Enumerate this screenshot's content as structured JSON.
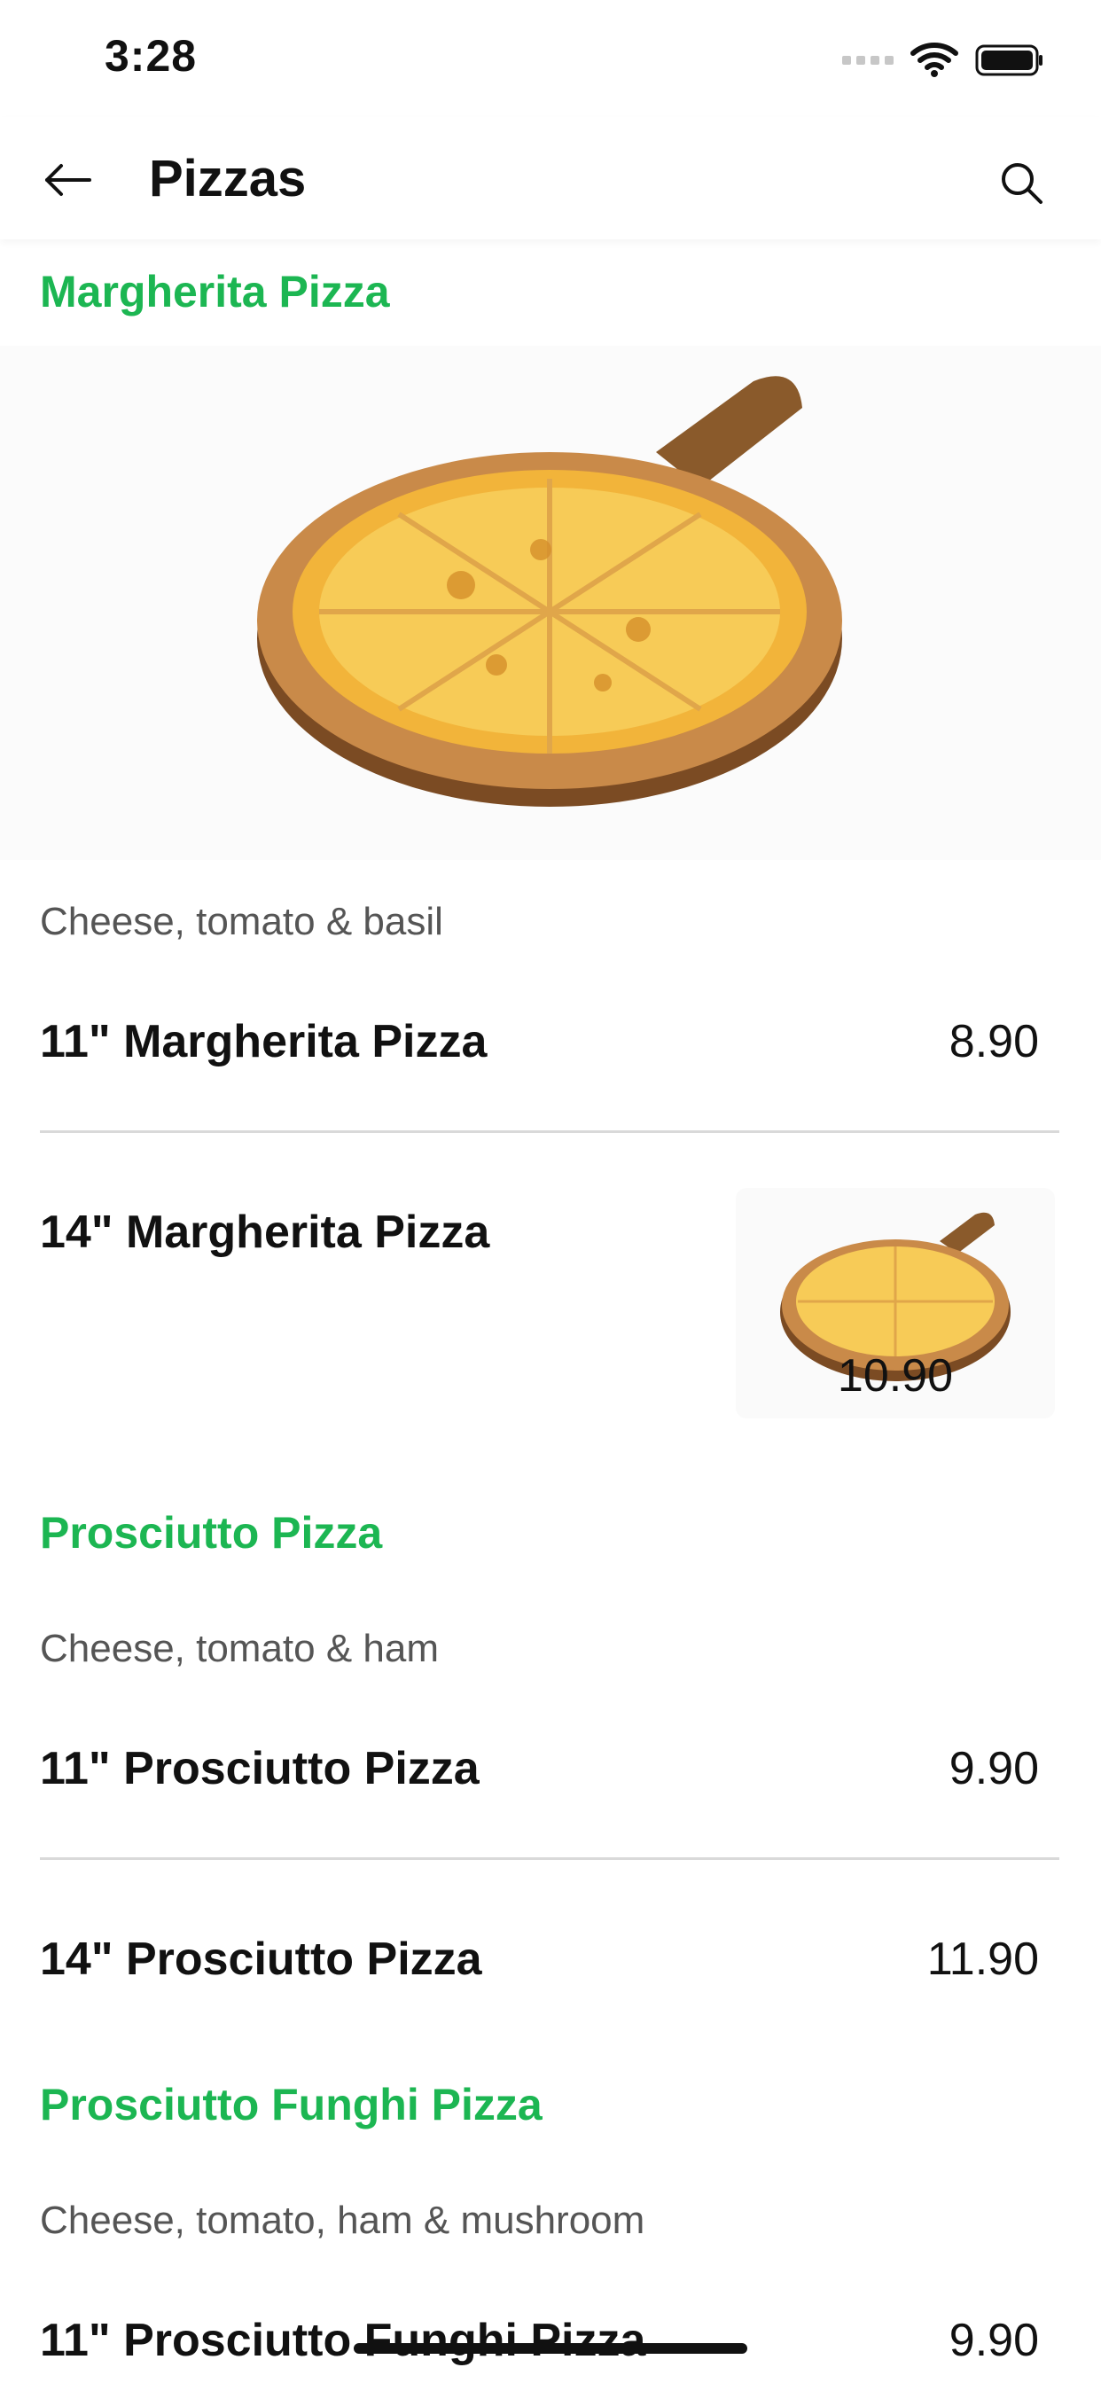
{
  "status_bar": {
    "time": "3:28"
  },
  "header": {
    "title": "Pizzas"
  },
  "sections": [
    {
      "title": "Margherita Pizza",
      "description": "Cheese, tomato & basil",
      "items": [
        {
          "name": "11\" Margherita Pizza",
          "price": "8.90"
        },
        {
          "name": "14\" Margherita Pizza",
          "price": "10.90"
        }
      ]
    },
    {
      "title": "Prosciutto Pizza",
      "description": "Cheese, tomato & ham",
      "items": [
        {
          "name": "11\" Prosciutto Pizza",
          "price": "9.90"
        },
        {
          "name": "14\" Prosciutto Pizza",
          "price": "11.90"
        }
      ]
    },
    {
      "title": "Prosciutto Funghi Pizza",
      "description": "Cheese, tomato, ham & mushroom",
      "items": [
        {
          "name": "11\" Prosciutto Funghi Pizza",
          "price": "9.90"
        }
      ]
    }
  ],
  "colors": {
    "accent_green": "#1cb652"
  },
  "icons": {
    "back": "arrow-left-icon",
    "search": "search-icon",
    "signal": "cellular-signal-icon",
    "wifi": "wifi-icon",
    "battery": "battery-icon"
  }
}
